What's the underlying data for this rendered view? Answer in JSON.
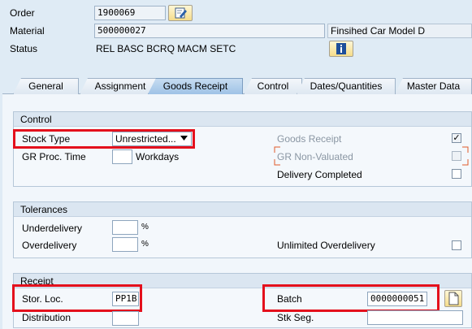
{
  "header": {
    "order_label": "Order",
    "order_value": "1900069",
    "material_label": "Material",
    "material_value": "500000027",
    "material_desc": "Finsihed Car Model D",
    "status_label": "Status",
    "status_value": "REL  BASC BCRQ MACM SETC"
  },
  "tabs": [
    {
      "label": "General"
    },
    {
      "label": "Assignment"
    },
    {
      "label": "Goods Receipt",
      "active": true
    },
    {
      "label": "Control"
    },
    {
      "label": "Dates/Quantities"
    },
    {
      "label": "Master Data"
    }
  ],
  "control": {
    "title": "Control",
    "stock_type_label": "Stock Type",
    "stock_type_value": "Unrestricted...",
    "gr_proc_time_label": "GR Proc. Time",
    "gr_proc_time_value": "",
    "gr_proc_time_unit": "Workdays",
    "goods_receipt_label": "Goods Receipt",
    "goods_receipt_checked": true,
    "gr_non_valuated_label": "GR Non-Valuated",
    "gr_non_valuated_checked": false,
    "delivery_completed_label": "Delivery Completed",
    "delivery_completed_checked": false
  },
  "tolerances": {
    "title": "Tolerances",
    "underdelivery_label": "Underdelivery",
    "underdelivery_value": "",
    "underdelivery_unit": "%",
    "overdelivery_label": "Overdelivery",
    "overdelivery_value": "",
    "overdelivery_unit": "%",
    "unlimited_label": "Unlimited Overdelivery",
    "unlimited_checked": false
  },
  "receipt": {
    "title": "Receipt",
    "stor_loc_label": "Stor. Loc.",
    "stor_loc_value": "PP1B",
    "batch_label": "Batch",
    "batch_value": "0000000051",
    "distribution_label": "Distribution",
    "stk_seg_label": "Stk Seg."
  },
  "colors": {
    "highlight": "#e4101c",
    "active_tab": "#9fc2e6",
    "icon_button": "#f5dc8a"
  }
}
